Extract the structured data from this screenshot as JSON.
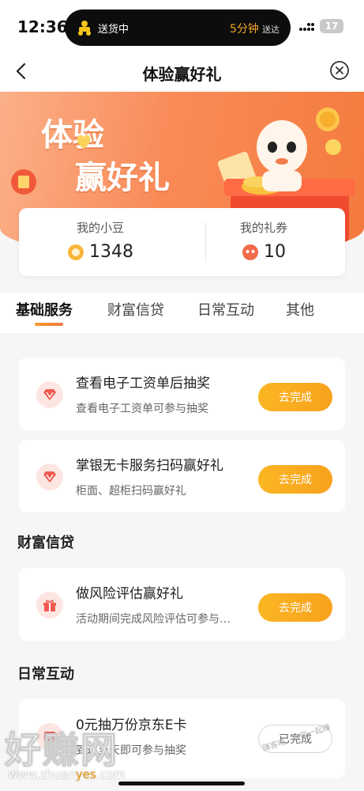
{
  "status_bar": {
    "time": "12:36",
    "island_left": "送货中",
    "island_right_accent": "5分钟",
    "island_right_soft": "送达",
    "battery": "17"
  },
  "header": {
    "title": "体验赢好礼"
  },
  "banner": {
    "line1": "体验",
    "line2": "赢好礼"
  },
  "stats": {
    "beans_label": "我的小豆",
    "beans_value": "1348",
    "coupons_label": "我的礼券",
    "coupons_value": "10"
  },
  "tabs": [
    "基础服务",
    "财富信贷",
    "日常互动",
    "其他"
  ],
  "sections": {
    "wealth": "财富信贷",
    "daily": "日常互动"
  },
  "tasks": [
    {
      "title": "查看电子工资单后抽奖",
      "desc": "查看电子工资单可参与抽奖",
      "button": "去完成"
    },
    {
      "title": "掌银无卡服务扫码赢好礼",
      "desc": "柜面、超柜扫码赢好礼",
      "button": "去完成"
    },
    {
      "title": "做风险评估赢好礼",
      "desc": "活动期间完成风险评估可参与…",
      "button": "去完成"
    },
    {
      "title": "0元抽万份京东E卡",
      "desc": "到达当天即可参与抽奖",
      "button": "已完成"
    }
  ],
  "watermark": {
    "big": "好赚网",
    "url_a": "www.zhuan",
    "url_b": "yes",
    "url_c": ".com",
    "side": "赚客吧，有奖一起赚"
  },
  "colors": {
    "accent": "#f7a21d",
    "banner": "#f98b58"
  }
}
